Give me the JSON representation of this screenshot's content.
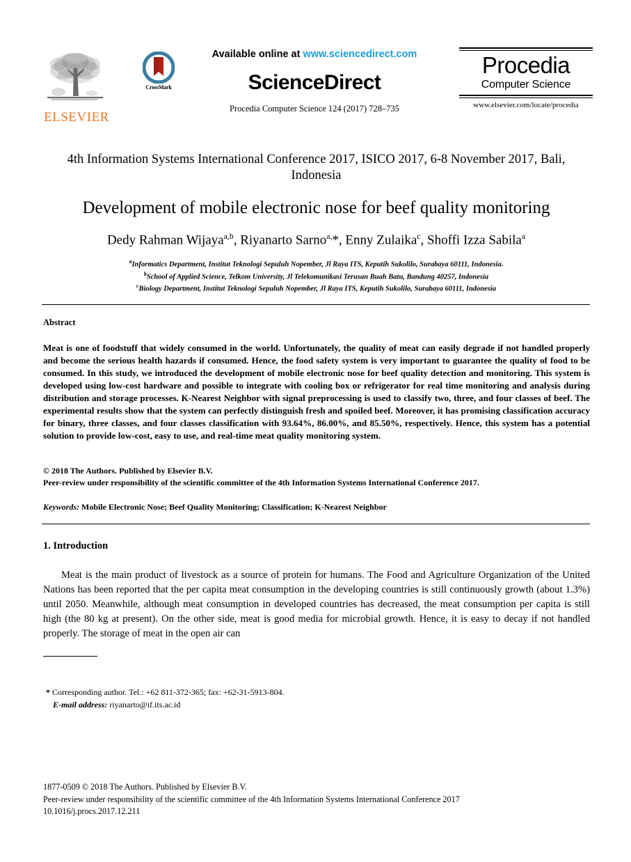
{
  "header": {
    "elsevier_logo_word": "ELSEVIER",
    "crossmark_label": "CrossMark",
    "available_online_prefix": "Available online at ",
    "available_online_url": "www.sciencedirect.com",
    "sciencedirect_wordmark": "ScienceDirect",
    "citation_line": "Procedia Computer Science 124 (2017) 728–735",
    "procedia_title": "Procedia",
    "procedia_subtitle": "Computer Science",
    "procedia_url": "www.elsevier.com/locate/procedia"
  },
  "conference": {
    "line": "4th Information Systems International Conference 2017, ISICO 2017, 6-8 November 2017, Bali, Indonesia"
  },
  "paper": {
    "title": "Development of mobile electronic nose for beef quality monitoring",
    "authors_html": "Dedy Rahman Wijaya<sup>a,b</sup>, Riyanarto Sarno<sup>a,</sup>*, Enny Zulaika<sup>c</sup>, Shoffi Izza Sabila<sup>a</sup>",
    "affiliations": [
      "Informatics Department, Institut Teknologi Sepuluh Nopember, Jl Raya ITS, Keputih Sukolilo, Surabaya 60111, Indonesia.",
      "School of Applied Science, Telkom University, Jl Telekomunikasi Terusan Buah Batu, Bandung 40257, Indonesia",
      "Biology Department, Institut Teknologi Sepuluh Nopember, Jl Raya ITS, Keputih Sukolilo, Surabaya 60111, Indonesia"
    ],
    "affiliation_marks": [
      "a",
      "b",
      "c"
    ]
  },
  "abstract": {
    "heading": "Abstract",
    "body": "Meat is one of foodstuff that widely consumed in the world. Unfortunately, the quality of meat can easily degrade if not handled properly and become the serious health hazards if consumed. Hence, the food safety system is very important to guarantee the quality of food to be consumed. In this study, we introduced the development of mobile electronic nose for beef quality detection and monitoring. This system is developed using low-cost hardware and possible to integrate with cooling box or refrigerator for real time monitoring and analysis during distribution and storage processes. K-Nearest Neighbor with signal preprocessing is used to classify two, three, and four classes of beef. The experimental results show that the system can perfectly distinguish fresh and spoiled beef. Moreover, it has promising classification accuracy for binary, three classes, and four classes classification with 93.64%, 86.00%, and 85.50%, respectively. Hence, this system has a potential solution to provide low-cost, easy to use, and real-time meat quality monitoring system.",
    "copyright_line_1": "© 2018 The Authors. Published by Elsevier B.V.",
    "copyright_line_2": "Peer-review under responsibility of the scientific committee of the 4th Information Systems International Conference 2017.",
    "keywords_label": "Keywords:",
    "keywords_value": " Mobile Electronic Nose; Beef Quality Monitoring; Classification; K-Nearest Neighbor"
  },
  "introduction": {
    "heading": "1. Introduction",
    "body": "Meat is the main product of livestock as a source of protein for humans. The Food and Agriculture Organization of the United Nations has been reported that the per capita meat consumption in the developing countries is still continuously growth (about 1.3%) until 2050. Meanwhile, although meat consumption in developed countries has decreased, the meat consumption per capita is still high (the 80 kg at present). On the other side, meat is good media for microbial growth. Hence, it is easy to decay if not handled properly. The storage of meat in the open air can"
  },
  "footnote": {
    "star": "*",
    "corresponding": " Corresponding author. Tel.: +62 811-372-365; fax: +62-31-5913-804.",
    "email_label": "E-mail address:",
    "email_value": " riyanarto@if.its.ac.id"
  },
  "page_footer": {
    "line_1": "1877-0509 © 2018 The Authors. Published by Elsevier B.V.",
    "line_2": "Peer-review under responsibility of the scientific committee of the 4th Information Systems International Conference 2017",
    "line_3": "10.1016/j.procs.2017.12.211"
  },
  "colors": {
    "elsevier_orange": "#E87722",
    "sciencedirect_link_blue": "#1E9BD7",
    "crossmark_blue": "#3B7EA1",
    "crossmark_red": "#B32316",
    "text": "#000000"
  }
}
